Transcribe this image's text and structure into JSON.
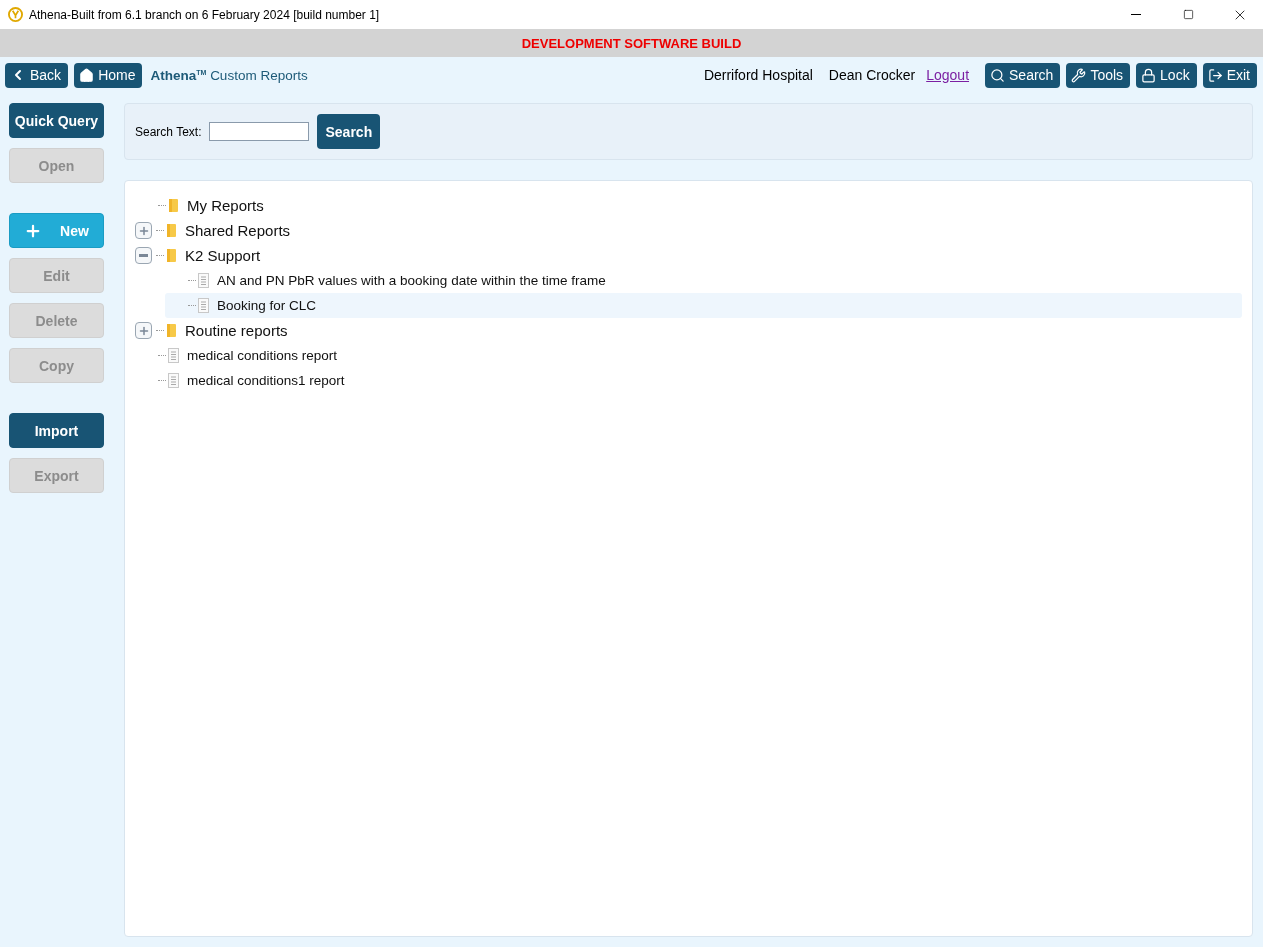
{
  "window": {
    "title": "Athena-Built from 6.1 branch on 6 February 2024 [build number 1]"
  },
  "banner": "DEVELOPMENT SOFTWARE BUILD",
  "nav": {
    "back": "Back",
    "home": "Home",
    "brand": "Athena",
    "brand_mark": "TM",
    "page": "Custom Reports",
    "location": "Derriford Hospital",
    "user": "Dean Crocker",
    "logout": "Logout",
    "actions": [
      {
        "kind": "search",
        "label": "Search"
      },
      {
        "kind": "tools",
        "label": "Tools"
      },
      {
        "kind": "lock",
        "label": "Lock"
      },
      {
        "kind": "exit",
        "label": "Exit"
      }
    ]
  },
  "sidebar_groups": [
    [
      {
        "kind": "primary",
        "label": "Quick Query",
        "disabled": false
      },
      {
        "kind": "primary",
        "label": "Open",
        "disabled": true
      }
    ],
    [
      {
        "kind": "new",
        "label": "New",
        "disabled": false
      },
      {
        "kind": "primary",
        "label": "Edit",
        "disabled": true
      },
      {
        "kind": "primary",
        "label": "Delete",
        "disabled": true
      },
      {
        "kind": "primary",
        "label": "Copy",
        "disabled": true
      }
    ],
    [
      {
        "kind": "primary",
        "label": "Import",
        "disabled": false
      },
      {
        "kind": "primary",
        "label": "Export",
        "disabled": true
      }
    ]
  ],
  "search": {
    "label": "Search Text:",
    "button": "Search"
  },
  "tree": [
    {
      "kind": "folder",
      "label": "My Reports",
      "selected": false
    },
    {
      "kind": "folder",
      "label": "Shared Reports",
      "expanded": false,
      "selected": false
    },
    {
      "kind": "folder",
      "label": "K2 Support",
      "expanded": true,
      "selected": false,
      "children": [
        {
          "kind": "report",
          "label": "AN and PN PbR values with a booking date within the time frame",
          "selected": false
        },
        {
          "kind": "report",
          "label": "Booking for CLC",
          "selected": true
        }
      ]
    },
    {
      "kind": "folder",
      "label": "Routine reports",
      "expanded": false,
      "selected": false
    },
    {
      "kind": "report",
      "label": "medical conditions report",
      "selected": false
    },
    {
      "kind": "report",
      "label": "medical conditions1 report",
      "selected": false
    }
  ]
}
